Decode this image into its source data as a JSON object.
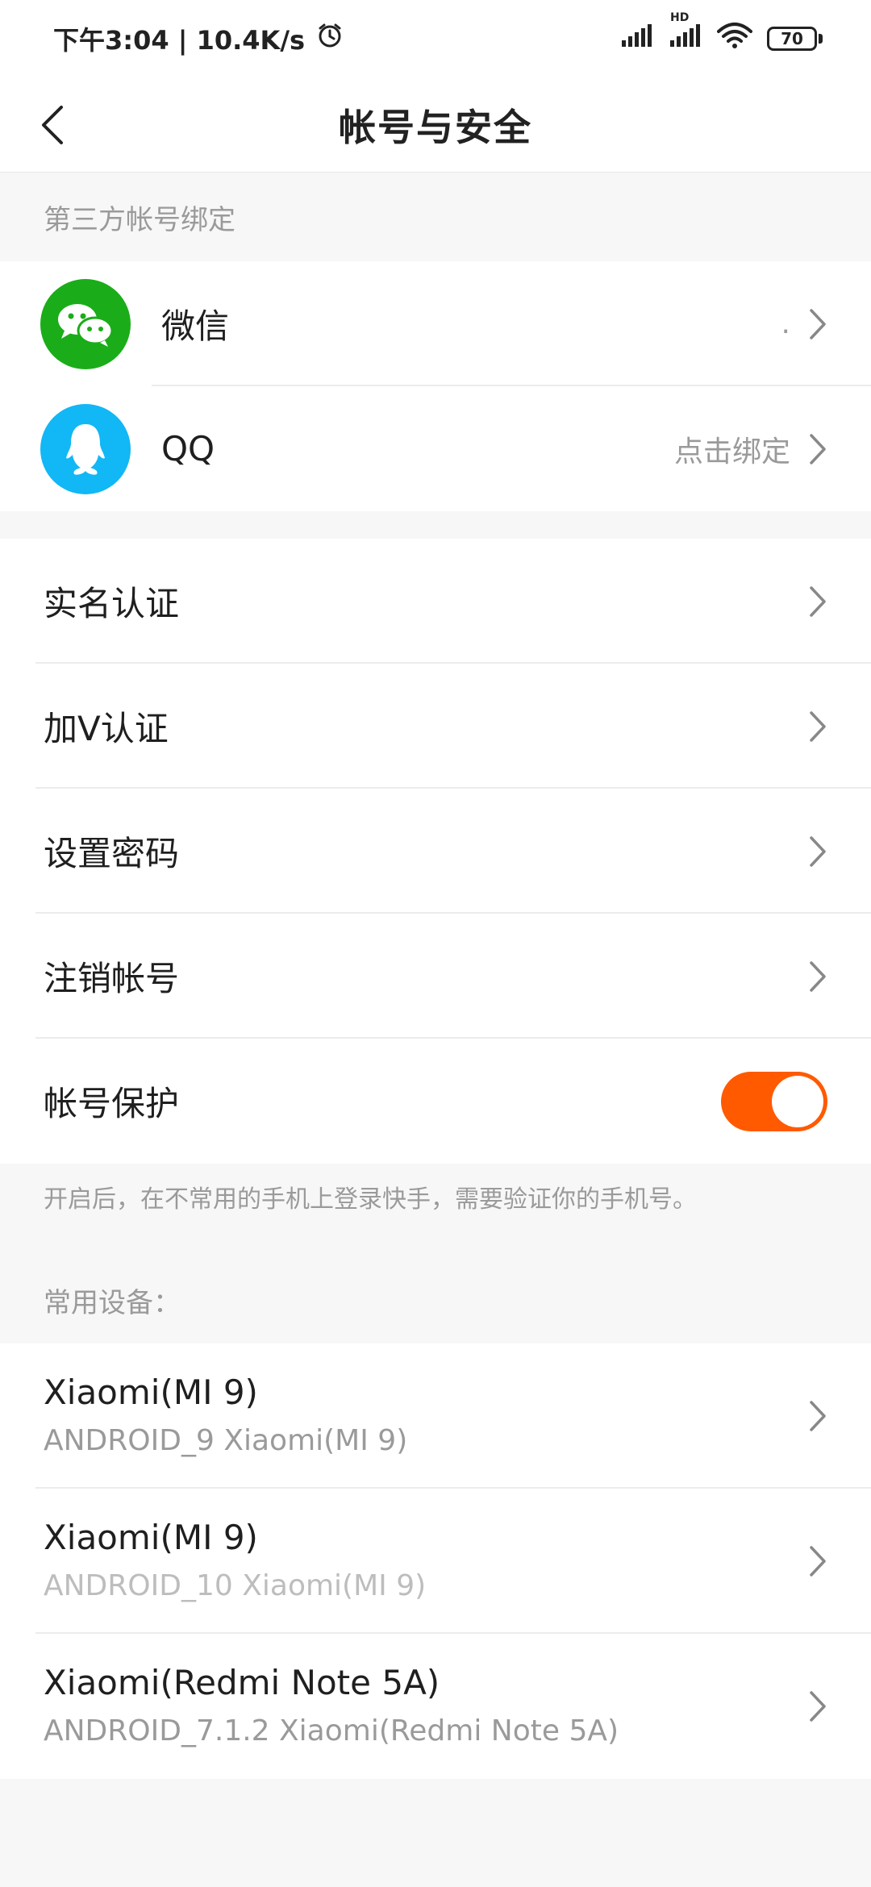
{
  "status_bar": {
    "time_speed": "下午3:04 | 10.4K/s",
    "battery": "70",
    "hd_label": "HD"
  },
  "nav": {
    "title": "帐号与安全"
  },
  "third_party": {
    "header": "第三方帐号绑定",
    "items": [
      {
        "label": "微信",
        "value": ".",
        "icon": "wechat-icon",
        "color": "#1aad19"
      },
      {
        "label": "QQ",
        "value": "点击绑定",
        "icon": "qq-icon",
        "color": "#12b7f5"
      }
    ]
  },
  "security": {
    "items": [
      {
        "label": "实名认证"
      },
      {
        "label": "加V认证"
      },
      {
        "label": "设置密码"
      },
      {
        "label": "注销帐号"
      }
    ],
    "protection_label": "帐号保护",
    "protection_enabled": true,
    "protection_hint": "开启后，在不常用的手机上登录快手，需要验证你的手机号。"
  },
  "devices": {
    "header": "常用设备：",
    "items": [
      {
        "name": "Xiaomi(MI 9)",
        "detail": "ANDROID_9 Xiaomi(MI 9)"
      },
      {
        "name": "Xiaomi(MI 9)",
        "detail": "ANDROID_10 Xiaomi(MI 9)"
      },
      {
        "name": "Xiaomi(Redmi Note 5A)",
        "detail": "ANDROID_7.1.2 Xiaomi(Redmi Note 5A)"
      }
    ]
  },
  "colors": {
    "accent": "#ff5a00",
    "wechat": "#1aad19",
    "qq": "#12b7f5"
  }
}
